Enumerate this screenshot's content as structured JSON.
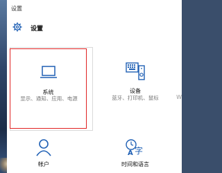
{
  "window": {
    "title": "设置"
  },
  "header": {
    "heading": "设置",
    "gear_icon": "gear-icon"
  },
  "tiles": [
    {
      "label": "系统",
      "desc": "显示、通知、应用、电源",
      "icon": "laptop-icon"
    },
    {
      "label": "设备",
      "desc": "蓝牙、打印机、鼠标",
      "icon": "devices-icon"
    },
    {
      "label": "帐户",
      "icon": "person-icon"
    },
    {
      "label": "时间和语言",
      "icon": "time-language-icon"
    }
  ],
  "right_edge_text": "W",
  "colors": {
    "highlight": "#e02020",
    "accent": "#1e5fb4"
  }
}
